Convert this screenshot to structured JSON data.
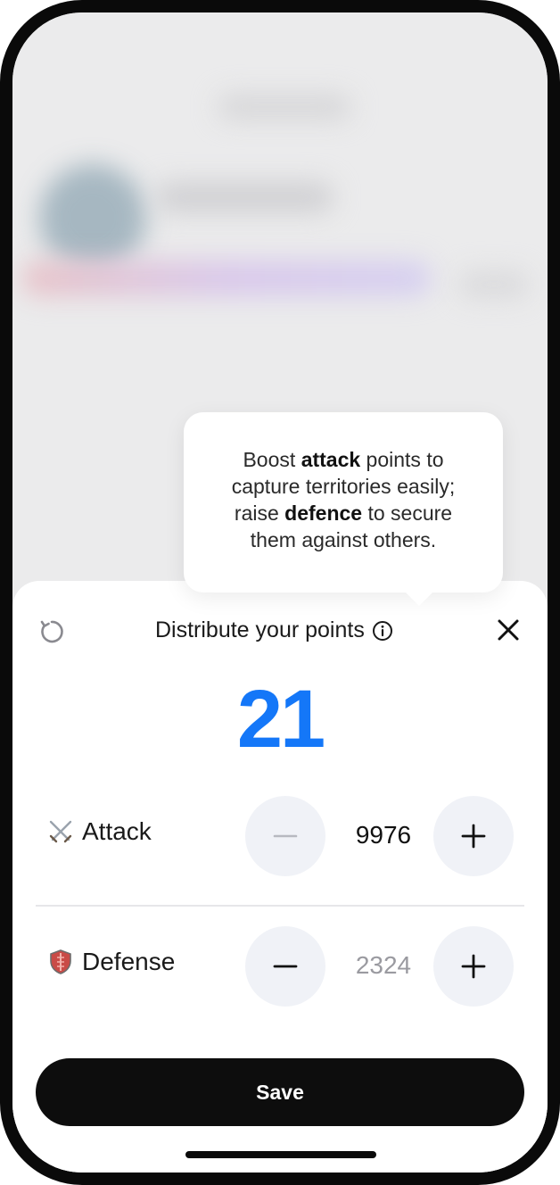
{
  "tooltip": {
    "line1_pre": "Boost ",
    "line1_bold": "attack",
    "line1_post": " points to",
    "line2": "capture territories easily;",
    "line3_pre": "raise ",
    "line3_bold": "defence",
    "line3_post": " to secure",
    "line4": "them against others."
  },
  "header": {
    "title": "Distribute your points",
    "refresh_icon": "refresh-icon",
    "info_icon": "info-icon",
    "close_icon": "close-icon"
  },
  "points_remaining": "21",
  "stats": {
    "attack": {
      "label": "Attack",
      "value": "9976",
      "icon": "crossed-swords-icon",
      "minus_disabled": true
    },
    "defense": {
      "label": "Defense",
      "value": "2324",
      "icon": "shield-icon",
      "minus_disabled": false
    }
  },
  "save_label": "Save",
  "colors": {
    "accent": "#1477f8",
    "button_bg": "#0d0d0d",
    "stepper_bg": "#f0f2f7",
    "muted_text": "#9a9aa0"
  }
}
